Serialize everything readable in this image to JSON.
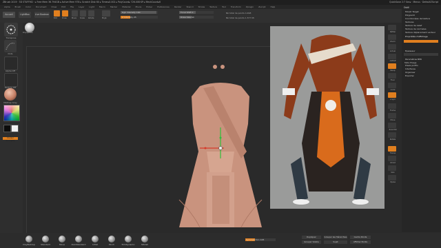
{
  "titlebar": {
    "title": "ZBrush 2019 · 3D STUFFHD · ▸ Free Mem 36.794GB ▸ Active Mem 978 ▸ Scratch Disk 60 ▸ Timer▸0.002 ▸ PolyCount▸ 726.008 KP ▸ MeshCount▸6",
    "right": "QuickSave 2:7 Sec▸ · Menus · DefaultZScript"
  },
  "menubar": {
    "items": [
      "Alpha",
      "Brush",
      "Color",
      "Document",
      "Draw",
      "Edit",
      "File",
      "Layer",
      "Light",
      "Macro",
      "Marker",
      "Material",
      "Movie",
      "Picker",
      "Preferences",
      "Render",
      "Stencil",
      "Stroke",
      "Texture",
      "Tool",
      "Transform",
      "Zplugin",
      "Zscript",
      "Help"
    ]
  },
  "toolbar": {
    "buttons": [
      {
        "label": "Accueil"
      },
      {
        "label": "LightBox"
      },
      {
        "label": "Live Boolean"
      }
    ],
    "modes": [
      "Edit",
      "Draw",
      "Move",
      "Scale",
      "Rotate"
    ],
    "sliders": [
      {
        "label": "Mrgb",
        "value": ""
      },
      {
        "label": "Rgb Intensity 100",
        "value": ""
      },
      {
        "label": "Z Intensity 25",
        "value": ""
      },
      {
        "label": "Focal Shift 0",
        "value": ""
      },
      {
        "label": "Draw Size 64",
        "value": ""
      }
    ],
    "info": [
      "Nb total de points 4.498",
      "Nb total de points 1.577 Mi"
    ]
  },
  "lefttray": {
    "labels": [
      "Transpose",
      "Dots",
      "Alpha Off",
      "Texture Off",
      "MatCap Gray",
      "Couleur Principale"
    ]
  },
  "polysphere_label": "PolySphere",
  "righttray": {
    "labels": [
      "Défiler",
      "Zoom",
      "Actual",
      "AAHalf",
      "Persp",
      "Floor",
      "Local",
      "L.Sym",
      "Frame",
      "Move",
      "Zoom3D",
      "Rotate",
      "Transp",
      "Ghost",
      "Solo",
      "Xpose"
    ]
  },
  "rightpanel": {
    "header": "Outil",
    "items": [
      "Morph Target",
      "Polypaint",
      "Coordonnées de texture",
      "Textures",
      "Texture de relief",
      "Texture de normales",
      "Texture déplacement vecteur",
      "Propriétés d'affichage",
      "Epaisseur",
      "Taille d'lisage",
      "Paramètres BPR",
      "Pixels profils",
      "Interfaces",
      "Organiser",
      "Exporter"
    ]
  },
  "bottombar": {
    "brushes": [
      "ClayBuildup",
      "Standard",
      "Move",
      "DamStandard",
      "Inflat",
      "Pinch",
      "TrimDynamic",
      "hPolish"
    ],
    "slider": "SymmetrXon 128",
    "buttons": [
      "Dupliquer",
      "Grouper les Hiérarchies",
      "Grouper Visible",
      "Sujet",
      "Centre Points",
      "Afficher Points"
    ]
  },
  "colors": {
    "accent": "#e07f1f",
    "panel": "#262626",
    "background": "#2b2b2b",
    "reference_bg": "#9a9b9a",
    "clay": "#c9937e"
  }
}
